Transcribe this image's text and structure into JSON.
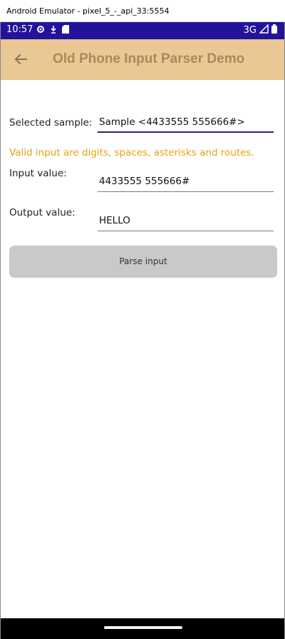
{
  "window": {
    "title": "Android Emulator - pixel_5_-_api_33:5554"
  },
  "status_bar": {
    "time": "10:57",
    "network": "3G",
    "icons_left": [
      "settings-icon",
      "download-icon",
      "sd-card-icon"
    ],
    "icons_right": [
      "signal-icon",
      "battery-icon"
    ]
  },
  "app_bar": {
    "title": "Old Phone Input Parser Demo",
    "back_icon": "arrow-left-icon",
    "color": "#e9c893"
  },
  "form": {
    "selected_sample_label": "Selected sample:",
    "selected_sample_value": "Sample <4433555 555666#>",
    "hint": "Valid input are digits, spaces, asterisks and routes.",
    "input_label": "Input value:",
    "input_value": "4433555 555666#",
    "output_label": "Output value:",
    "output_value": "HELLO",
    "parse_button": "Parse input"
  },
  "colors": {
    "status_bar": "#23139a",
    "hint": "#e6a20f",
    "picker_underline": "#3a1c6e"
  }
}
